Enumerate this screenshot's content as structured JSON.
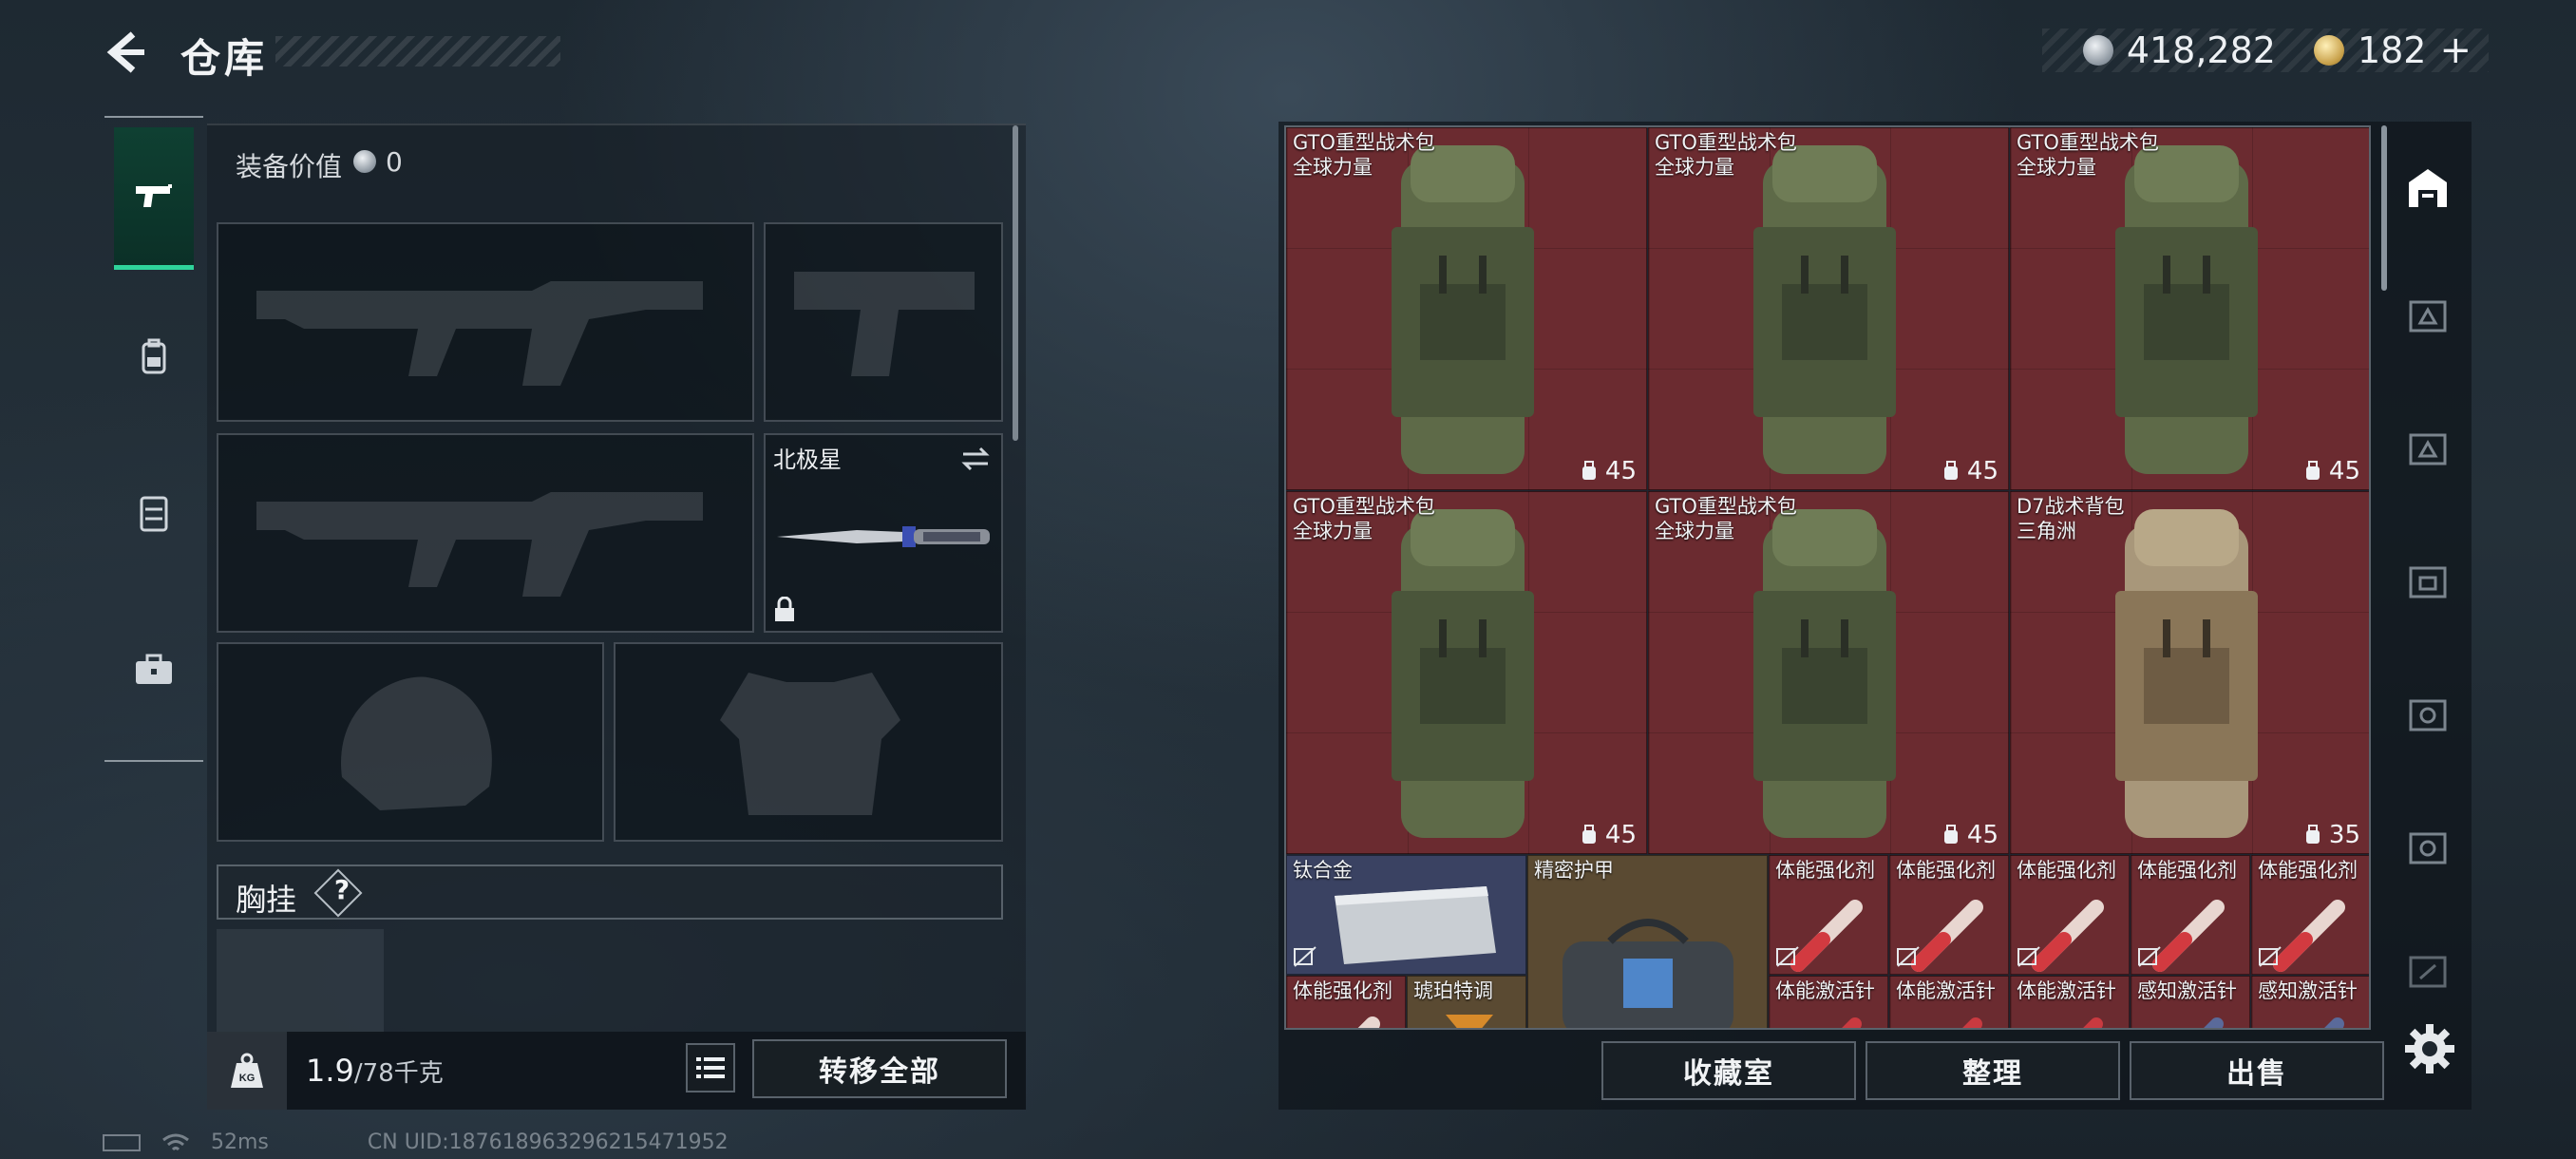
{
  "header": {
    "title": "仓库",
    "silver_amount": "418,282",
    "gold_amount": "182",
    "plus_label": "+"
  },
  "left_nav": {
    "items": [
      {
        "icon": "pistol-icon",
        "active": true
      },
      {
        "icon": "backpack-icon",
        "active": false
      },
      {
        "icon": "chest-rig-icon",
        "active": false
      },
      {
        "icon": "toolbox-icon",
        "active": false
      }
    ]
  },
  "loadout": {
    "equip_value_label": "装备价值",
    "equip_value": "0",
    "melee_name": "北极星",
    "chest_label": "胸挂",
    "chest_help": "?",
    "weight_current": "1.9",
    "weight_max": "/78千克",
    "transfer_all_label": "转移全部"
  },
  "storage_items": [
    {
      "name": "GTO重型战术包",
      "sub": "全球力量",
      "capacity": "45",
      "color": "olive"
    },
    {
      "name": "GTO重型战术包",
      "sub": "全球力量",
      "capacity": "45",
      "color": "olive"
    },
    {
      "name": "GTO重型战术包",
      "sub": "全球力量",
      "capacity": "45",
      "color": "olive"
    },
    {
      "name": "GTO重型战术包",
      "sub": "全球力量",
      "capacity": "45",
      "color": "olive"
    },
    {
      "name": "GTO重型战术包",
      "sub": "全球力量",
      "capacity": "45",
      "color": "olive"
    },
    {
      "name": "D7战术背包",
      "sub": "三角洲",
      "capacity": "35",
      "color": "tan"
    }
  ],
  "small_items": [
    {
      "name": "钛合金"
    },
    {
      "name": "精密护甲"
    },
    {
      "name": "体能强化剂"
    },
    {
      "name": "体能强化剂"
    },
    {
      "name": "体能强化剂"
    },
    {
      "name": "体能强化剂"
    },
    {
      "name": "体能强化剂"
    },
    {
      "name": "体能强化剂"
    },
    {
      "name": "琥珀特调"
    },
    {
      "name": "体能激活针"
    },
    {
      "name": "体能激活针"
    },
    {
      "name": "体能激活针"
    },
    {
      "name": "感知激活针"
    },
    {
      "name": "感知激活针"
    }
  ],
  "actions": {
    "collection_label": "收藏室",
    "organize_label": "整理",
    "sell_label": "出售"
  },
  "status": {
    "ping": "52ms",
    "uid": "CN UID:18761896329621547195​2"
  },
  "colors": {
    "accent_green": "#2fd39b",
    "red_item_bg": "#6b2b30",
    "blue_item_bg": "#3a4262",
    "gold_item_bg": "#5a4a32"
  }
}
